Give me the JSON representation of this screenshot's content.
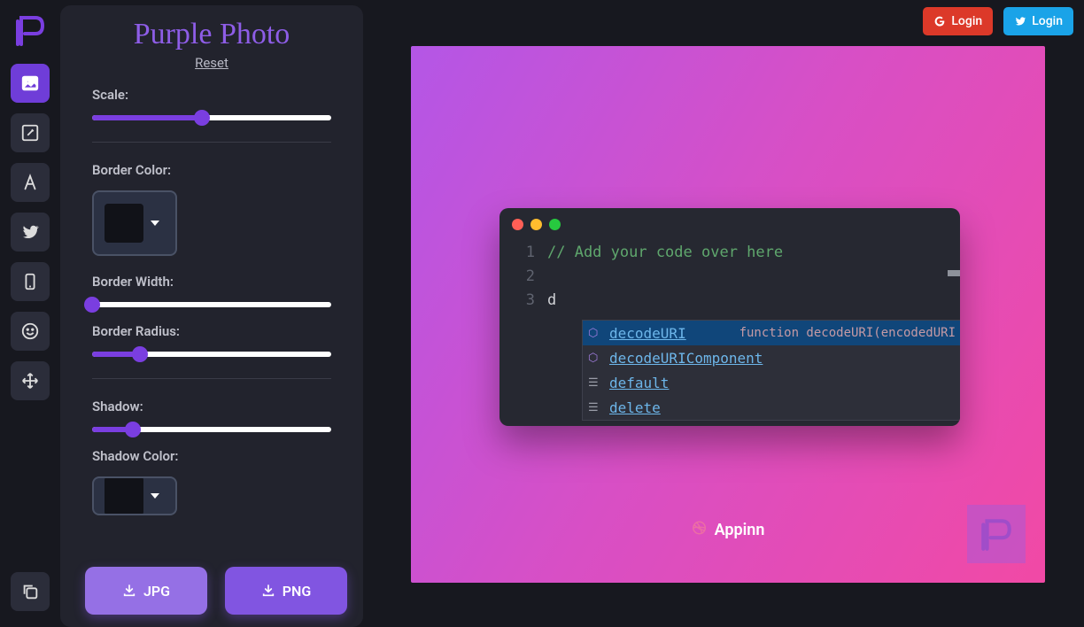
{
  "app": {
    "title": "Purple Photo",
    "reset": "Reset"
  },
  "login": {
    "google": "Login",
    "twitter": "Login"
  },
  "sliders": {
    "scale": {
      "label": "Scale:",
      "pct": 46
    },
    "borderWidth": {
      "label": "Border Width:",
      "pct": 0
    },
    "borderRadius": {
      "label": "Border Radius:",
      "pct": 20
    },
    "shadow": {
      "label": "Shadow:",
      "pct": 17
    }
  },
  "colors": {
    "borderColor": {
      "label": "Border Color:",
      "hex": "#111218"
    },
    "shadowColor": {
      "label": "Shadow Color:",
      "hex": "#111218"
    }
  },
  "download": {
    "jpg": "JPG",
    "png": "PNG"
  },
  "code": {
    "lines": [
      "1",
      "2",
      "3"
    ],
    "comment": "// Add your code over here",
    "typed": "d"
  },
  "autocomplete": {
    "items": [
      {
        "label": "decodeURI",
        "detail": "function decodeURI(encodedURI",
        "type": "func"
      },
      {
        "label": "decodeURIComponent",
        "detail": "",
        "type": "func"
      },
      {
        "label": "default",
        "detail": "",
        "type": "word"
      },
      {
        "label": "delete",
        "detail": "",
        "type": "word"
      }
    ]
  },
  "watermark": {
    "text": "Appinn"
  }
}
